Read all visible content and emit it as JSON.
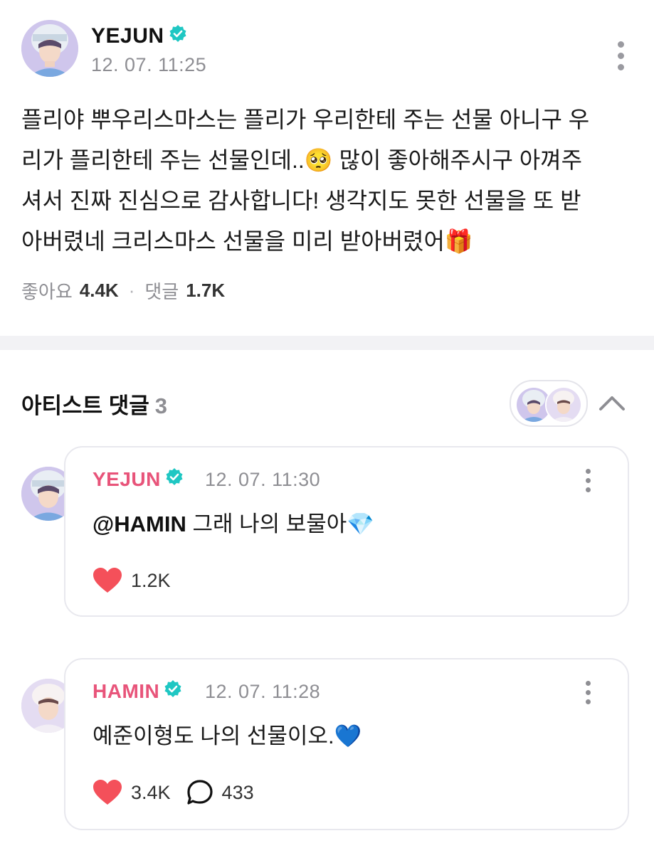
{
  "post": {
    "author": "YEJUN",
    "time": "12. 07. 11:25",
    "body_lines": [
      "플리야 뿌우리스마스는 플리가 우리한테 주는 선물 아니구 우",
      "리가 플리한테 주는 선물인데..🥺  많이 좋아해주시구 아껴주",
      "셔서 진짜 진심으로 감사합니다! 생각지도 못한 선물을 또 받",
      "아버렸네 크리스마스 선물을 미리 받아버렸어🎁"
    ],
    "likes_label": "좋아요",
    "likes_count": "4.4K",
    "comments_label": "댓글",
    "comments_count": "1.7K"
  },
  "artist_comments": {
    "title": "아티스트 댓글",
    "count": "3",
    "items": [
      {
        "author": "YEJUN",
        "time": "12. 07. 11:30",
        "mention": "@HAMIN",
        "text": " 그래 나의 보물아💎",
        "likes": "1.2K"
      },
      {
        "author": "HAMIN",
        "time": "12. 07. 11:28",
        "text": "예준이형도 나의 선물이오.💙",
        "likes": "3.4K",
        "replies": "433"
      }
    ]
  },
  "icons": {
    "verified": "verified-badge-icon",
    "more": "more-vertical-icon",
    "collapse": "chevron-up-icon",
    "like": "heart-icon",
    "reply": "speech-bubble-icon"
  },
  "colors": {
    "accent_pink": "#e8547a",
    "verified_teal": "#1fc7c3",
    "heart_red": "#f4505a",
    "muted_gray": "#8e8e93"
  }
}
